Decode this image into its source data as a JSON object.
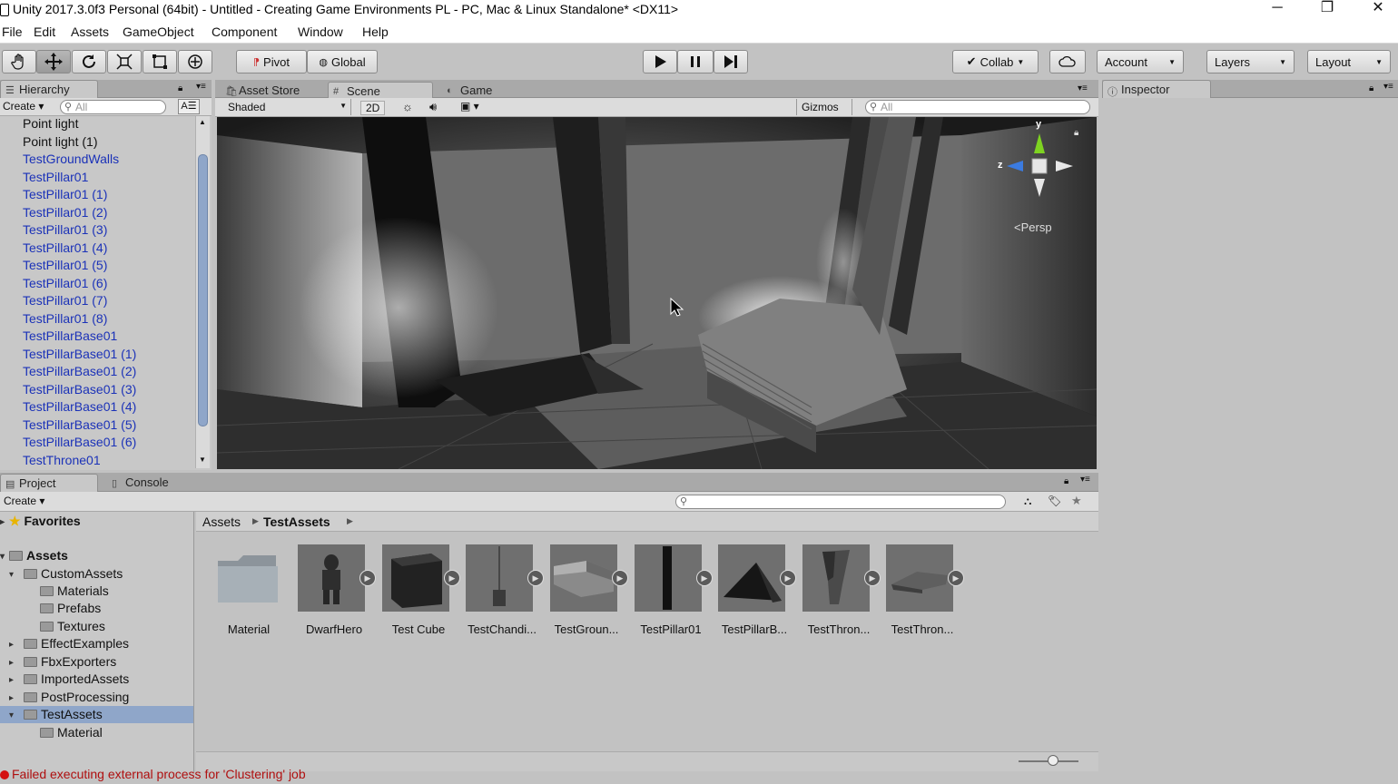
{
  "window": {
    "title": "Unity 2017.3.0f3 Personal (64bit) - Untitled - Creating Game Environments PL - PC, Mac & Linux Standalone* <DX11>",
    "minimize": "─",
    "restore": "❐",
    "close": "✕"
  },
  "menu": [
    "File",
    "Edit",
    "Assets",
    "GameObject",
    "Component",
    "Window",
    "Help"
  ],
  "toolbar": {
    "tools": [
      "hand-icon",
      "move-icon",
      "rotate-icon",
      "scale-icon",
      "rect-icon",
      "transform-icon"
    ],
    "pivot_label": "Pivot",
    "global_label": "Global",
    "collab_label": "Collab",
    "account_label": "Account",
    "layers_label": "Layers",
    "layout_label": "Layout"
  },
  "hierarchy": {
    "tab": "Hierarchy",
    "create_label": "Create",
    "search_placeholder": "All",
    "items": [
      {
        "label": "Point light",
        "prefab": false
      },
      {
        "label": "Point light (1)",
        "prefab": false
      },
      {
        "label": "TestGroundWalls",
        "prefab": true
      },
      {
        "label": "TestPillar01",
        "prefab": true
      },
      {
        "label": "TestPillar01 (1)",
        "prefab": true
      },
      {
        "label": "TestPillar01 (2)",
        "prefab": true
      },
      {
        "label": "TestPillar01 (3)",
        "prefab": true
      },
      {
        "label": "TestPillar01 (4)",
        "prefab": true
      },
      {
        "label": "TestPillar01 (5)",
        "prefab": true
      },
      {
        "label": "TestPillar01 (6)",
        "prefab": true
      },
      {
        "label": "TestPillar01 (7)",
        "prefab": true
      },
      {
        "label": "TestPillar01 (8)",
        "prefab": true
      },
      {
        "label": "TestPillarBase01",
        "prefab": true
      },
      {
        "label": "TestPillarBase01 (1)",
        "prefab": true
      },
      {
        "label": "TestPillarBase01 (2)",
        "prefab": true
      },
      {
        "label": "TestPillarBase01 (3)",
        "prefab": true
      },
      {
        "label": "TestPillarBase01 (4)",
        "prefab": true
      },
      {
        "label": "TestPillarBase01 (5)",
        "prefab": true
      },
      {
        "label": "TestPillarBase01 (6)",
        "prefab": true
      },
      {
        "label": "TestThrone01",
        "prefab": true
      }
    ]
  },
  "scene": {
    "tabs": [
      "Asset Store",
      "Scene",
      "Game"
    ],
    "shading_mode": "Shaded",
    "mode_2d": "2D",
    "gizmos_label": "Gizmos",
    "search_placeholder": "All",
    "gizmo": {
      "y_label": "y",
      "z_label": "z",
      "projection": "Persp"
    }
  },
  "inspector": {
    "tab": "Inspector"
  },
  "project": {
    "tabs": [
      "Project",
      "Console"
    ],
    "create_label": "Create",
    "breadcrumb": [
      "Assets",
      "TestAssets"
    ],
    "tree": {
      "favorites": "Favorites",
      "assets": "Assets",
      "custom_assets": "CustomAssets",
      "custom_children": [
        "Materials",
        "Prefabs",
        "Textures"
      ],
      "other_folders": [
        "EffectExamples",
        "FbxExporters",
        "ImportedAssets",
        "PostProcessing"
      ],
      "selected": "TestAssets",
      "selected_children": [
        "Material"
      ]
    },
    "assets": [
      "Material",
      "DwarfHero",
      "Test Cube",
      "TestChandi...",
      "TestGroun...",
      "TestPillar01",
      "TestPillarB...",
      "TestThron...",
      "TestThron..."
    ]
  },
  "status": {
    "message": "Failed executing external process for 'Clustering' job"
  },
  "colors": {
    "prefab_text": "#1b32b8",
    "selection": "#8fa6c9",
    "error": "#b01010"
  }
}
